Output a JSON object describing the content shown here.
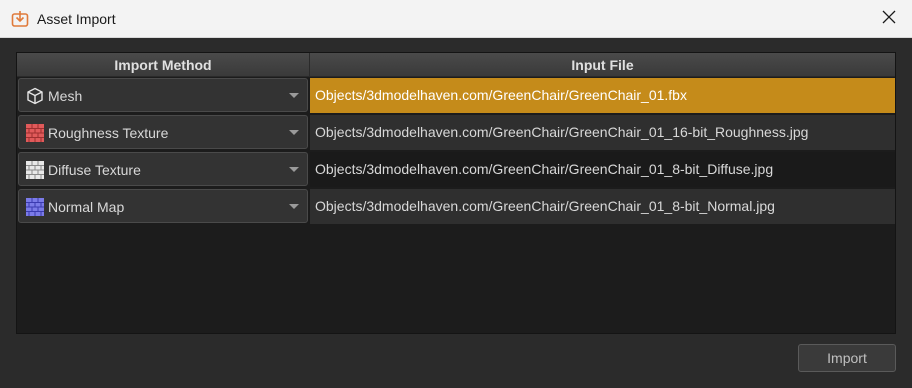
{
  "window": {
    "title": "Asset Import",
    "title_icon": "import-icon",
    "close_icon": "close-icon"
  },
  "table": {
    "columns": [
      "Import Method",
      "Input File"
    ],
    "rows": [
      {
        "method": "Mesh",
        "icon": "cube-icon",
        "file": "Objects/3dmodelhaven.com/GreenChair/GreenChair_01.fbx",
        "selected": true
      },
      {
        "method": "Roughness Texture",
        "icon": "roughness-texture-icon",
        "file": "Objects/3dmodelhaven.com/GreenChair/GreenChair_01_16-bit_Roughness.jpg",
        "selected": false
      },
      {
        "method": "Diffuse Texture",
        "icon": "diffuse-texture-icon",
        "file": "Objects/3dmodelhaven.com/GreenChair/GreenChair_01_8-bit_Diffuse.jpg",
        "selected": false
      },
      {
        "method": "Normal Map",
        "icon": "normal-map-icon",
        "file": "Objects/3dmodelhaven.com/GreenChair/GreenChair_01_8-bit_Normal.jpg",
        "selected": false
      }
    ]
  },
  "footer": {
    "import_label": "Import"
  },
  "colors": {
    "selection": "#c58b1a",
    "roughness": "#e05a5a",
    "diffuse": "#e8e8e8",
    "normal": "#7b7be8",
    "title_icon": "#e07a3a"
  }
}
